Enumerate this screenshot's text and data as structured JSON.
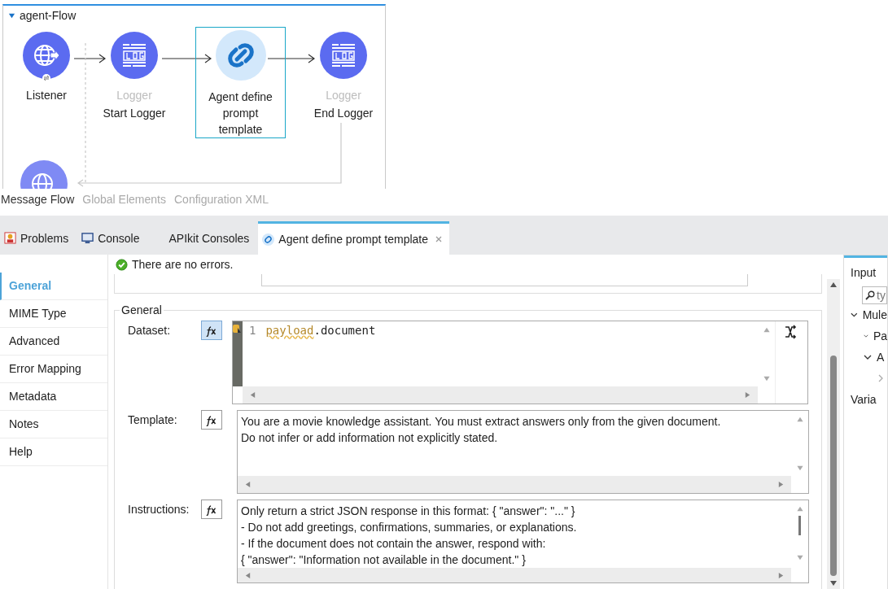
{
  "flow": {
    "name": "agent-Flow",
    "expanded": true,
    "nodes": [
      {
        "kind": "listener",
        "label": "Listener",
        "selected": false
      },
      {
        "kind": "logger",
        "type_label": "Logger",
        "label": "Start Logger",
        "selected": false
      },
      {
        "kind": "agent",
        "label": "Agent define prompt template",
        "selected": true
      },
      {
        "kind": "logger",
        "type_label": "Logger",
        "label": "End Logger",
        "selected": false
      }
    ]
  },
  "editor_tabs": [
    {
      "label": "Message Flow",
      "selected": true
    },
    {
      "label": "Global Elements",
      "selected": false
    },
    {
      "label": "Configuration XML",
      "selected": false
    }
  ],
  "panel_tabs": [
    {
      "kind": "problems",
      "label": "Problems",
      "selected": false
    },
    {
      "kind": "console",
      "label": "Console",
      "selected": false
    },
    {
      "kind": "apikit",
      "label": "APIkit Consoles",
      "selected": false
    },
    {
      "kind": "agent",
      "label": "Agent define prompt template",
      "selected": true,
      "closable": true
    }
  ],
  "sidebar": {
    "items": [
      {
        "label": "General",
        "selected": true
      },
      {
        "label": "MIME Type",
        "selected": false
      },
      {
        "label": "Advanced",
        "selected": false
      },
      {
        "label": "Error Mapping",
        "selected": false
      },
      {
        "label": "Metadata",
        "selected": false
      },
      {
        "label": "Notes",
        "selected": false
      },
      {
        "label": "Help",
        "selected": false
      }
    ]
  },
  "status": "There are no errors.",
  "section": {
    "title": "General",
    "fields": [
      {
        "kind": "code",
        "label": "Dataset:",
        "fx_on": true,
        "line_number": "1",
        "tokens": [
          {
            "kind": "variable",
            "text": "payload"
          },
          {
            "kind": "plain",
            "text": ".document"
          }
        ]
      },
      {
        "kind": "text",
        "label": "Template:",
        "fx_on": false,
        "lines": [
          "You are a movie knowledge assistant. You must extract answers only from the given document.",
          "Do not infer or add information not explicitly stated."
        ]
      },
      {
        "kind": "text",
        "label": "Instructions:",
        "fx_on": false,
        "lines": [
          "Only return a strict JSON response in this format: { \"answer\": \"...\" }",
          "- Do not add greetings, confirmations, summaries, or explanations.",
          "- If the document does not contain the answer, respond with:",
          "{ \"answer\": \"Information not available in the document.\" }"
        ]
      }
    ]
  },
  "right_panel": {
    "tab": "Input",
    "search_placeholder": "ty",
    "tree": [
      {
        "label": "Mule",
        "expanded": true,
        "children": [
          {
            "label": "Pa",
            "expanded": true
          },
          {
            "label": "A",
            "expanded": true,
            "children": [
              {
                "expanded": false
              }
            ]
          }
        ]
      },
      {
        "label": "Varia"
      }
    ]
  }
}
